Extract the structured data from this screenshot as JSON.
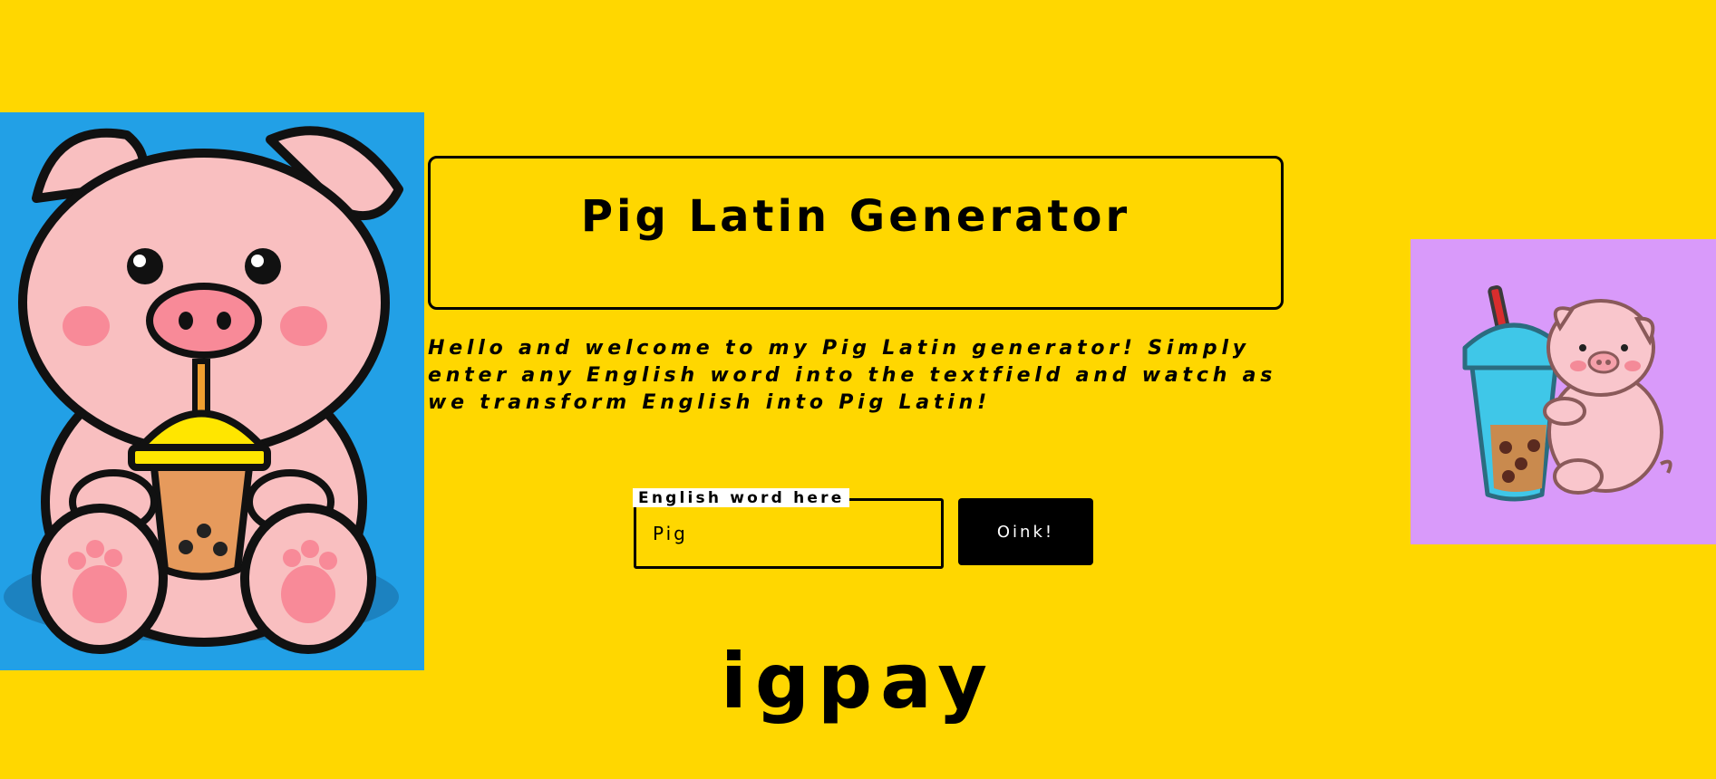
{
  "header": {
    "title": "Pig Latin Generator"
  },
  "intro": {
    "text": "Hello and welcome to my Pig Latin generator! Simply enter any English word into the textfield and watch as we transform English into Pig Latin!"
  },
  "form": {
    "input_label": "English word here",
    "input_value": "Pig",
    "submit_label": "Oink!"
  },
  "result": {
    "text": "igpay"
  },
  "colors": {
    "background": "#FFD700",
    "left_image_background": "#22A0E6",
    "right_image_background": "#D99AFA",
    "button": "#000000"
  }
}
